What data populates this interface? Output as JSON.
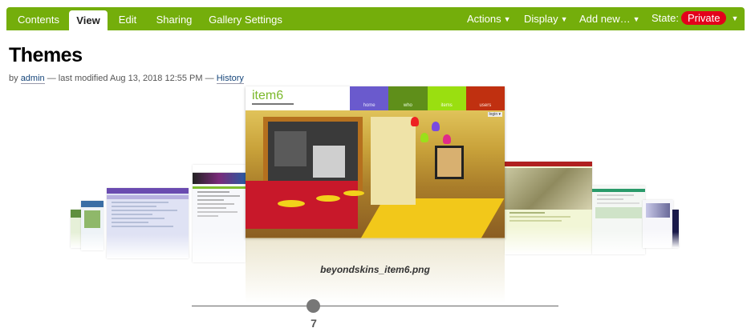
{
  "toolbar": {
    "tabs": [
      {
        "label": "Contents"
      },
      {
        "label": "View"
      },
      {
        "label": "Edit"
      },
      {
        "label": "Sharing"
      },
      {
        "label": "Gallery Settings"
      }
    ],
    "active_tab": "View",
    "menus": {
      "actions": "Actions",
      "display": "Display",
      "add_new": "Add new…",
      "state_label": "State:",
      "state_value": "Private"
    }
  },
  "page": {
    "title": "Themes",
    "byline": {
      "by": "by",
      "author": "admin",
      "modified": "— last modified Aug 13, 2018 12:55 PM —",
      "history": "History"
    }
  },
  "gallery": {
    "current_caption": "beyondskins_item6.png",
    "current_index": "7",
    "featured": {
      "logo": "item6",
      "nav": [
        {
          "label": "home",
          "color": "#6a5acd"
        },
        {
          "label": "who",
          "color": "#5f8f1a"
        },
        {
          "label": "items",
          "color": "#9adf10"
        },
        {
          "label": "users",
          "color": "#c03010"
        }
      ],
      "login": "login ▾"
    }
  },
  "colors": {
    "toolbar": "#74ae0b",
    "state_badge": "#e3001b"
  }
}
